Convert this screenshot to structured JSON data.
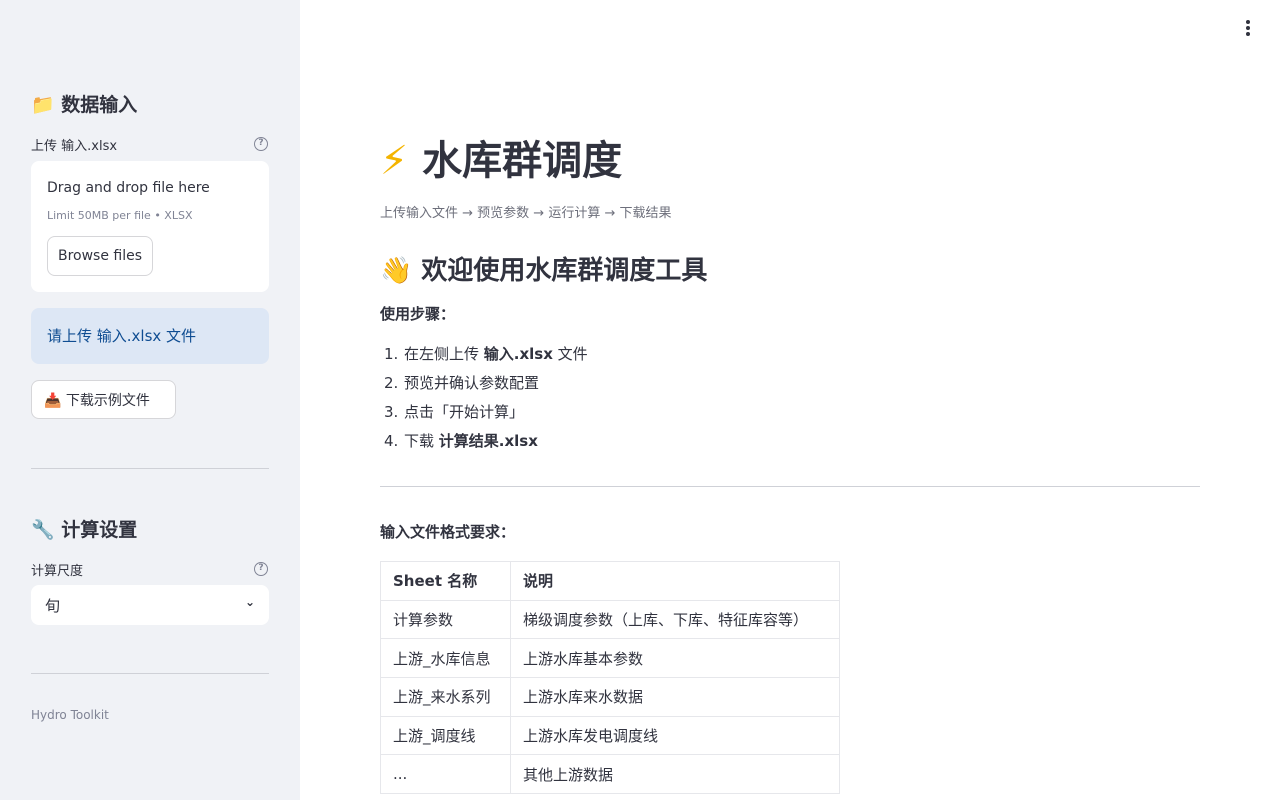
{
  "sidebar": {
    "input_header": "📁 数据输入",
    "upload_label": "上传 输入.xlsx",
    "uploader": {
      "drag_text": "Drag and drop file here",
      "limit_text": "Limit 50MB per file • XLSX",
      "browse_label": "Browse files"
    },
    "info_text": "请上传 输入.xlsx 文件",
    "download_label": "📥 下载示例文件",
    "settings_header": "🔧 计算设置",
    "scale_label": "计算尺度",
    "scale_value": "旬",
    "footer": "Hydro Toolkit"
  },
  "main": {
    "title_icon": "⚡",
    "title": "水库群调度",
    "steps_caption": "上传输入文件 → 预览参数 → 运行计算 → 下载结果",
    "welcome": "👋 欢迎使用水库群调度工具",
    "usage_title": "使用步骤：",
    "usage_steps": [
      {
        "num": "1.",
        "pre": "在左侧上传 ",
        "bold": "输入.xlsx",
        "post": " 文件"
      },
      {
        "num": "2.",
        "pre": "预览并确认参数配置",
        "bold": "",
        "post": ""
      },
      {
        "num": "3.",
        "pre": "点击「开始计算」",
        "bold": "",
        "post": ""
      },
      {
        "num": "4.",
        "pre": "下载 ",
        "bold": "计算结果.xlsx",
        "post": ""
      }
    ],
    "format_title": "输入文件格式要求：",
    "table": {
      "headers": [
        "Sheet 名称",
        "说明"
      ],
      "rows": [
        [
          "计算参数",
          "梯级调度参数（上库、下库、特征库容等）"
        ],
        [
          "上游_水库信息",
          "上游水库基本参数"
        ],
        [
          "上游_来水系列",
          "上游水库来水数据"
        ],
        [
          "上游_调度线",
          "上游水库发电调度线"
        ],
        [
          "...",
          "其他上游数据"
        ]
      ]
    }
  }
}
